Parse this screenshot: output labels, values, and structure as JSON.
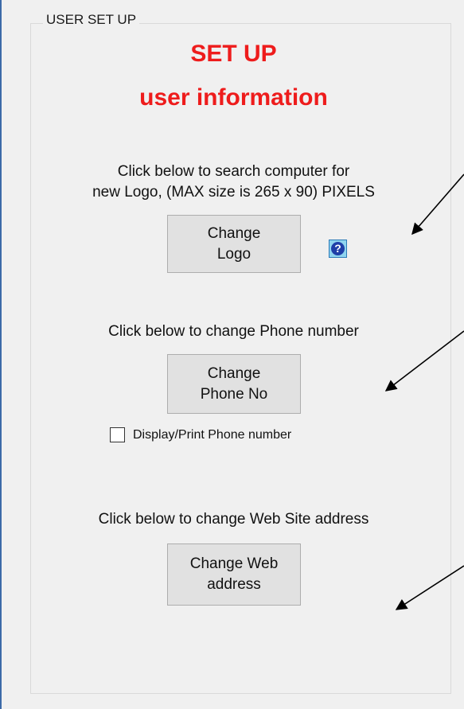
{
  "group": {
    "label": "USER SET UP"
  },
  "heading": {
    "line1": "SET UP",
    "line2": "user information"
  },
  "logo_section": {
    "instruction_line1": "Click below to search computer for",
    "instruction_line2": "new Logo, (MAX size is 265 x 90) PIXELS",
    "button_line1": "Change",
    "button_line2": "Logo",
    "help_icon": "question-mark-icon",
    "help_symbol": "?"
  },
  "phone_section": {
    "instruction": "Click below to change Phone number",
    "button_line1": "Change",
    "button_line2": "Phone No",
    "checkbox_label": "Display/Print Phone number",
    "checkbox_checked": false
  },
  "web_section": {
    "instruction": "Click below to change Web Site address",
    "button_line1": "Change Web",
    "button_line2": "address"
  },
  "colors": {
    "heading": "#ee1c1c",
    "window_border": "#3c6aa8",
    "button_face": "#e1e1e1",
    "help_icon_bg": "#8fd4ef",
    "help_icon_fg": "#1f3fa8"
  }
}
